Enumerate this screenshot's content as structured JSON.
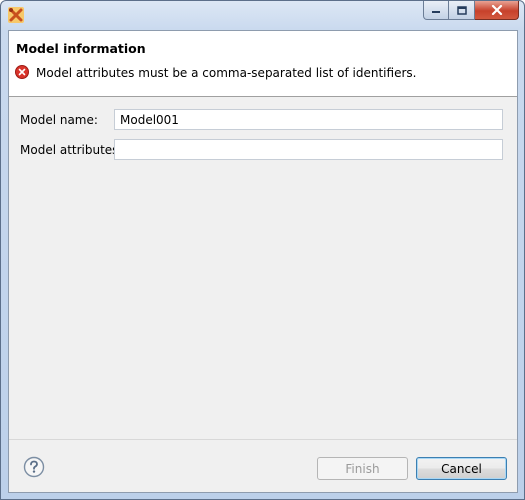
{
  "dialog": {
    "title": ""
  },
  "header": {
    "title": "Model information",
    "error_message": "Model attributes must be a comma-separated list of identifiers."
  },
  "form": {
    "model_name": {
      "label": "Model name:",
      "value": "Model001"
    },
    "model_attributes": {
      "label": "Model attributes:",
      "value": ""
    }
  },
  "buttons": {
    "finish": "Finish",
    "cancel": "Cancel"
  },
  "icons": {
    "app": "eclipse-tools-icon",
    "error": "error-icon",
    "help": "help-icon"
  },
  "colors": {
    "error_red": "#d9342b",
    "close_red": "#c7412b"
  }
}
